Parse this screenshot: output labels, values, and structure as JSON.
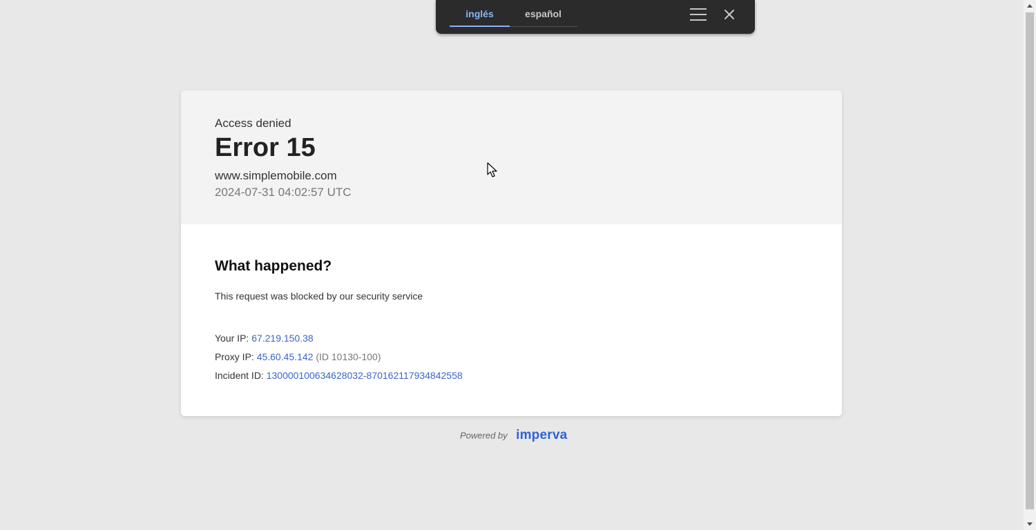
{
  "translate_bar": {
    "tabs": [
      {
        "label": "inglés",
        "active": true
      },
      {
        "label": "español",
        "active": false
      }
    ],
    "icons": [
      "menu-icon",
      "close-icon"
    ]
  },
  "header": {
    "label": "Access denied",
    "title": "Error 15",
    "domain": "www.simplemobile.com",
    "timestamp": "2024-07-31 04:02:57 UTC"
  },
  "body": {
    "heading": "What happened?",
    "description": "This request was blocked by our security service",
    "ip": {
      "label": "Your IP:",
      "value": "67.219.150.38"
    },
    "proxy": {
      "label": "Proxy IP:",
      "value": "45.60.45.142",
      "extra": "(ID 10130-100)"
    },
    "incident": {
      "label": "Incident ID:",
      "value": "130000100634628032-870162117934842558"
    }
  },
  "footer": {
    "powered_by": "Powered by",
    "brand": "imperva"
  },
  "colors": {
    "link": "#3b64c8",
    "brand": "#2f62d9",
    "active_tab": "#8ab4f8",
    "toolbar_bg": "#2b2b2b"
  }
}
